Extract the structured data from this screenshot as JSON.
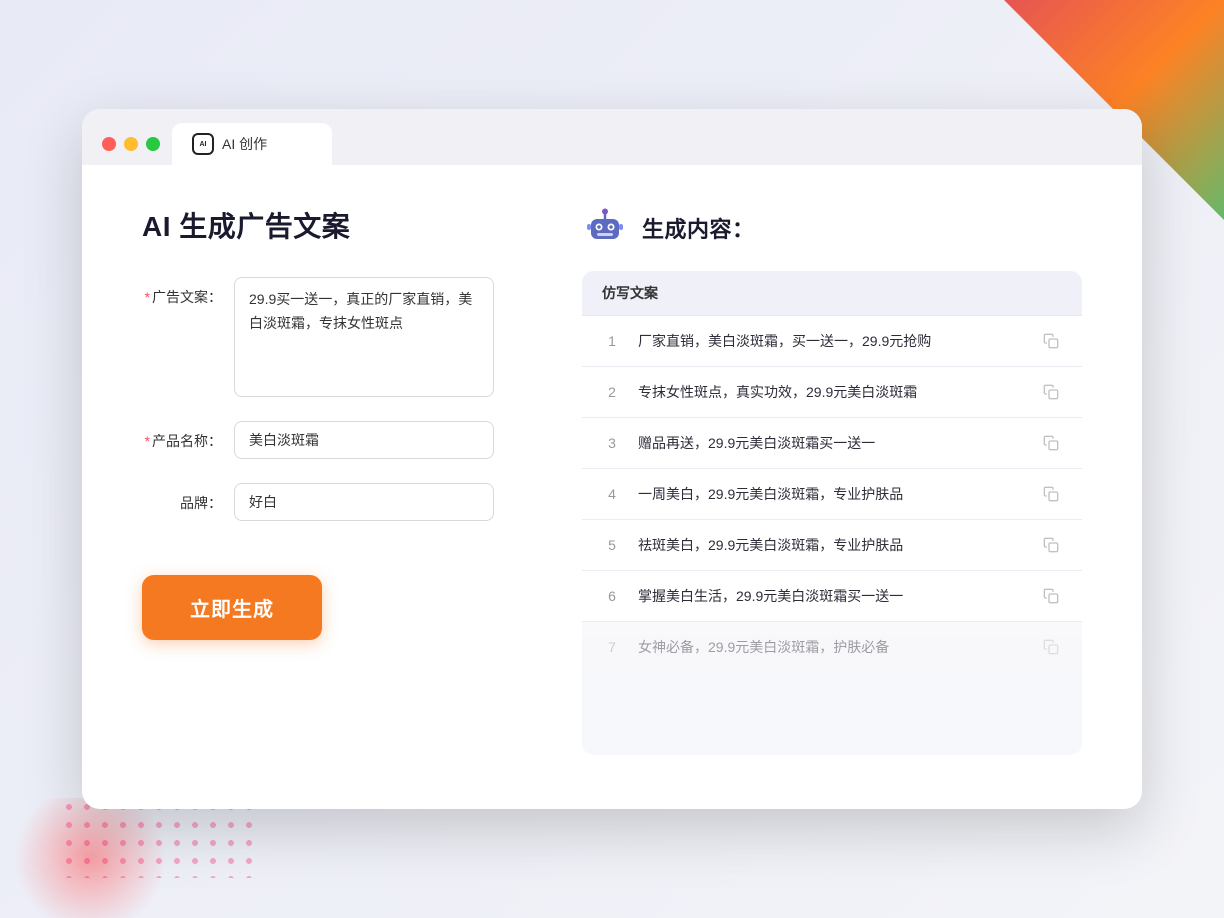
{
  "window": {
    "tab_label": "AI 创作",
    "tab_icon": "ai-icon"
  },
  "page": {
    "title": "AI 生成广告文案",
    "result_title": "生成内容："
  },
  "form": {
    "ad_copy_label": "广告文案：",
    "ad_copy_required": "*",
    "ad_copy_value": "29.9买一送一，真正的厂家直销，美白淡斑霜，专抹女性斑点",
    "product_name_label": "产品名称：",
    "product_name_required": "*",
    "product_name_value": "美白淡斑霜",
    "brand_label": "品牌：",
    "brand_value": "好白",
    "generate_button": "立即生成"
  },
  "results": {
    "header_label": "仿写文案",
    "items": [
      {
        "number": "1",
        "text": "厂家直销，美白淡斑霜，买一送一，29.9元抢购",
        "faded": false
      },
      {
        "number": "2",
        "text": "专抹女性斑点，真实功效，29.9元美白淡斑霜",
        "faded": false
      },
      {
        "number": "3",
        "text": "赠品再送，29.9元美白淡斑霜买一送一",
        "faded": false
      },
      {
        "number": "4",
        "text": "一周美白，29.9元美白淡斑霜，专业护肤品",
        "faded": false
      },
      {
        "number": "5",
        "text": "祛斑美白，29.9元美白淡斑霜，专业护肤品",
        "faded": false
      },
      {
        "number": "6",
        "text": "掌握美白生活，29.9元美白淡斑霜买一送一",
        "faded": false
      },
      {
        "number": "7",
        "text": "女神必备，29.9元美白淡斑霜，护肤必备",
        "faded": true
      }
    ]
  },
  "colors": {
    "accent_orange": "#f47920",
    "accent_blue": "#5c6bc0",
    "required_red": "#ff4d4f"
  }
}
